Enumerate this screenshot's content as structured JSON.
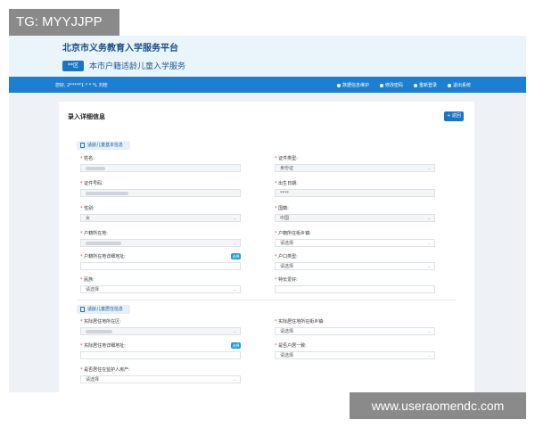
{
  "watermarks": {
    "top_left": "TG: MYYJJPP",
    "bottom_right": "www.useraomendc.com"
  },
  "header": {
    "site_title": "北京市义务教育入学服务平台",
    "service_badge": "**区",
    "service_title": "本市户籍适龄儿童入学服务"
  },
  "navbar": {
    "welcome": "您好, 2*****1 * * *L 刘桂",
    "items": [
      {
        "label": "数据信息维护",
        "icon": "info-icon"
      },
      {
        "label": "修改密码",
        "icon": "lock-icon"
      },
      {
        "label": "重新登录",
        "icon": "refresh-icon"
      },
      {
        "label": "退出系统",
        "icon": "logout-icon"
      }
    ]
  },
  "main": {
    "title": "录入详细信息",
    "back_button": "+ 返回"
  },
  "section1": {
    "title": "适龄儿童基本信息",
    "fields": {
      "name_label": "姓名:",
      "idtype_label": "证件类型:",
      "idtype_value": "身份证",
      "idno_label": "证件号码:",
      "birth_label": "出生日期:",
      "birth_value": "****",
      "gender_label": "性别:",
      "gender_value": "女",
      "nation_label": "国籍:",
      "nation_value": "中国",
      "hukou_label": "户籍所在地:",
      "hukou_street_label": "户籍所在街乡镇:",
      "hukou_street_value": "请选择",
      "hukou_addr_label": "户籍所在地详细地址:",
      "hukou_addr_btn": "选择",
      "household_label": "户口类型:",
      "household_value": "请选择",
      "ethnic_label": "民族:",
      "ethnic_value": "请选择",
      "remark_label": "特长爱好:"
    }
  },
  "section2": {
    "title": "适龄儿童居住信息",
    "fields": {
      "res_label": "实际居住地所在区:",
      "res_street_label": "实际居住地所在街乡镇:",
      "res_street_value": "请选择",
      "res_addr_label": "实际居住地详细地址:",
      "res_addr_btn": "选择",
      "same_label": "是否户居一致:",
      "same_value": "请选择",
      "guardian_label": "是否居住在监护人房产:",
      "guardian_value": "请选择"
    }
  },
  "colors": {
    "primary": "#1d7fd1",
    "header_bg": "#eaf4fb",
    "page_bg": "#eef1f5"
  }
}
